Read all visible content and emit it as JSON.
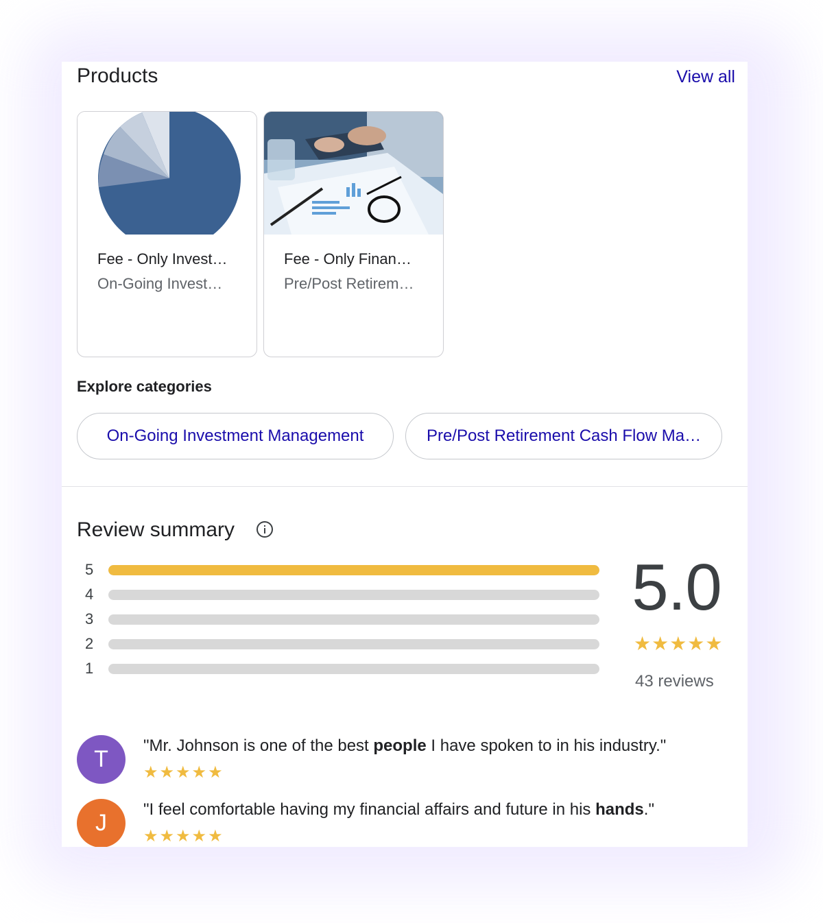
{
  "products": {
    "title": "Products",
    "view_all": "View all",
    "items": [
      {
        "name": "Fee - Only Invest…",
        "subtitle": "On-Going Invest…",
        "thumbnail": "pie-chart-image"
      },
      {
        "name": "Fee - Only Finan…",
        "subtitle": "Pre/Post Retirem…",
        "thumbnail": "office-documents-photo"
      }
    ]
  },
  "categories": {
    "title": "Explore categories",
    "chips": [
      "On-Going Investment Management",
      "Pre/Post Retirement Cash Flow Ma…"
    ]
  },
  "review_summary": {
    "title": "Review summary",
    "score": "5.0",
    "stars": "★★★★★",
    "count": "43 reviews",
    "distribution": [
      {
        "label": "5",
        "fraction": 1.0
      },
      {
        "label": "4",
        "fraction": 0.0
      },
      {
        "label": "3",
        "fraction": 0.0
      },
      {
        "label": "2",
        "fraction": 0.0
      },
      {
        "label": "1",
        "fraction": 0.0
      }
    ],
    "colors": {
      "star": "#f0bb40",
      "track": "#d8d8d8",
      "link": "#1a0dab"
    }
  },
  "reviews": [
    {
      "initial": "T",
      "avatar_color": "#7e57c2",
      "before": "\"Mr. Johnson is one of the best ",
      "bold": "people",
      "after": " I have spoken to in his industry.\"",
      "stars": "★★★★★"
    },
    {
      "initial": "J",
      "avatar_color": "#e8712d",
      "before": "\"I feel comfortable having my financial affairs and future in his ",
      "bold": "hands",
      "after": ".\"",
      "stars": "★★★★★"
    }
  ]
}
